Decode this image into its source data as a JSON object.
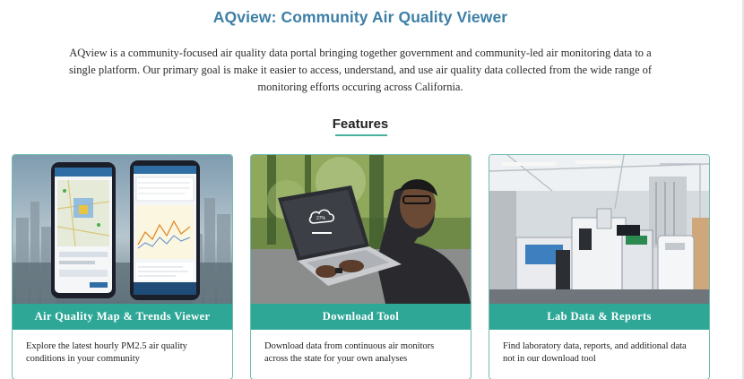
{
  "page": {
    "title": "AQview: Community Air Quality Viewer",
    "intro": "AQview is a community-focused air quality data portal bringing together government and community-led air monitoring data to a single platform. Our primary goal is make it easier to access, understand, and use air quality data collected from the wide range of monitoring efforts occuring across California.",
    "features_heading": "Features"
  },
  "cards": [
    {
      "title": "Air Quality Map & Trends Viewer",
      "description": "Explore the latest hourly PM2.5 air quality conditions in your community",
      "image": "phones-showing-air-quality-map-image"
    },
    {
      "title": "Download Tool",
      "description": "Download data from continuous air monitors across the state for your own analyses",
      "image": "laptop-cloud-download-image"
    },
    {
      "title": "Lab Data & Reports",
      "description": "Find laboratory data, reports, and additional data not in our download tool",
      "image": "laboratory-instruments-image"
    }
  ],
  "colors": {
    "title": "#3d7fa6",
    "accent": "#2fa797",
    "card_border": "#6fbdb0"
  }
}
